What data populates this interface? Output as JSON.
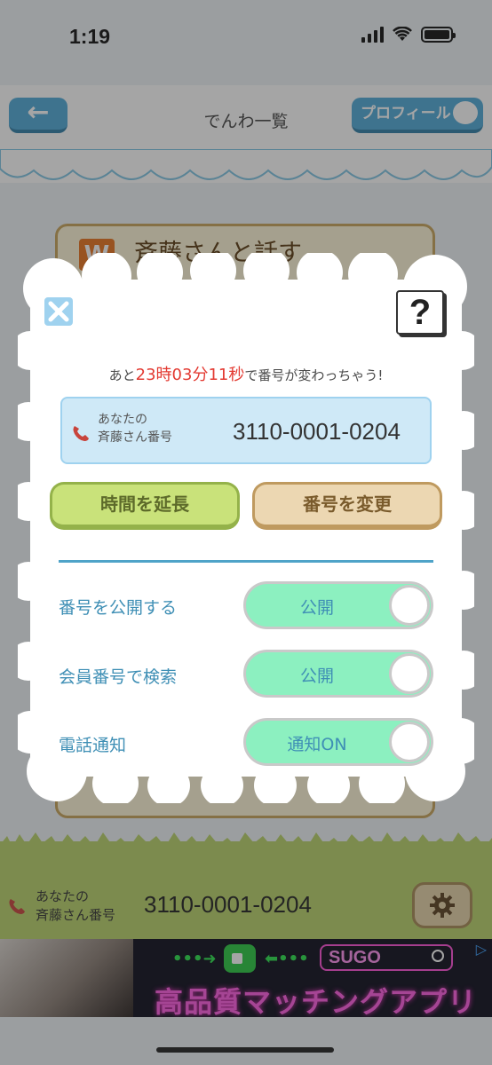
{
  "status_bar": {
    "time": "1:19"
  },
  "nav": {
    "back_label": "←",
    "title": "でんわ一覧",
    "profile_label": "プロフィール"
  },
  "background_card": {
    "badge": "W",
    "title": "斉藤さんと話す"
  },
  "modal": {
    "close_label": "×",
    "help_label": "?",
    "countdown": {
      "prefix": "あと",
      "hours": "23時",
      "minutes": "03分",
      "seconds": "11秒",
      "suffix": "で番号が変わっちゃう!"
    },
    "number_box": {
      "label_line1": "あなたの",
      "label_line2": "斉藤さん番号",
      "number": "3110-0001-0204"
    },
    "extend_button": "時間を延長",
    "change_button": "番号を変更",
    "settings": [
      {
        "label": "番号を公開する",
        "toggle": "公開",
        "on": true
      },
      {
        "label": "会員番号で検索",
        "toggle": "公開",
        "on": true
      },
      {
        "label": "電話通知",
        "toggle": "通知ON",
        "on": true
      }
    ]
  },
  "footer": {
    "label_line1": "あなたの",
    "label_line2": "斉藤さん番号",
    "number": "3110-0001-0204"
  },
  "ad": {
    "search_text": "SUGO",
    "headline": "高品質マッチングアプリ",
    "choices": "▷"
  },
  "colors": {
    "accent_blue": "#4fa3c8",
    "countdown_red": "#e33a32",
    "toggle_green": "#8cf0c0"
  }
}
